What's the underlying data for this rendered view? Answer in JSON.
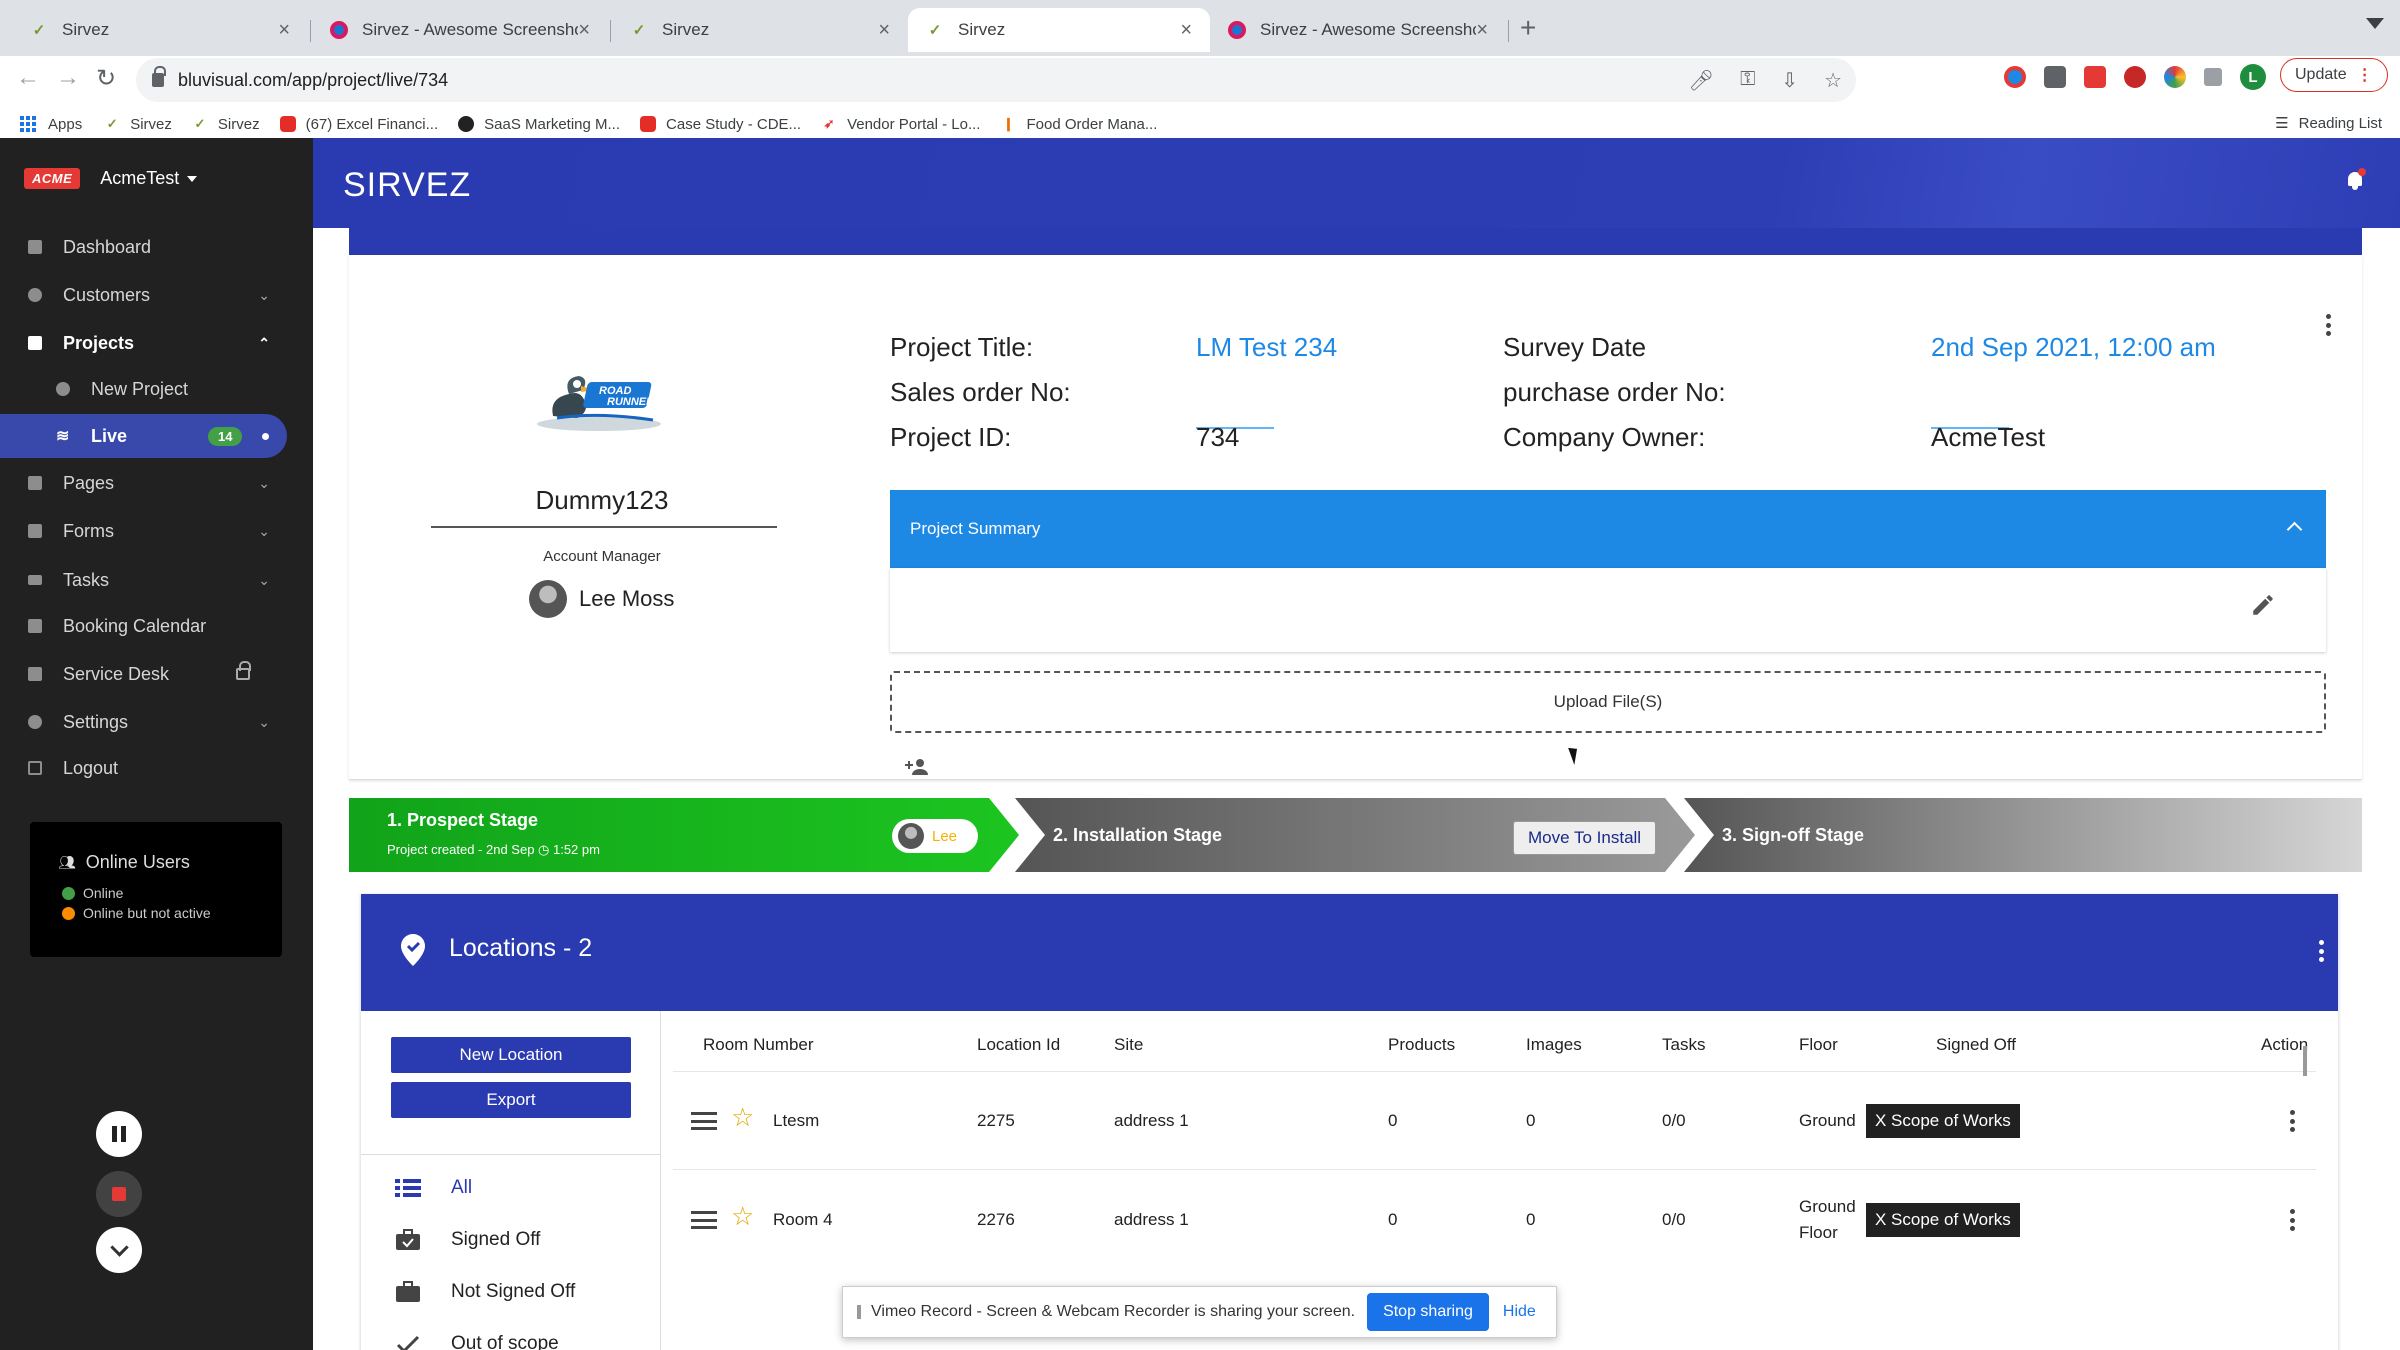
{
  "browser": {
    "tabs": [
      {
        "title": "Sirvez",
        "icon": "sirvez-check-icon"
      },
      {
        "title": "Sirvez - Awesome Screenshot",
        "icon": "awesome-screenshot-icon"
      },
      {
        "title": "Sirvez",
        "icon": "sirvez-check-icon"
      },
      {
        "title": "Sirvez",
        "icon": "sirvez-check-icon",
        "active": true
      },
      {
        "title": "Sirvez - Awesome Screenshot",
        "icon": "awesome-screenshot-icon"
      }
    ],
    "url": "bluvisual.com/app/project/live/734",
    "profile_letter": "L",
    "update_label": "Update",
    "bookmarks": [
      {
        "label": "Apps"
      },
      {
        "label": "Sirvez"
      },
      {
        "label": "Sirvez"
      },
      {
        "label": "(67) Excel Financi..."
      },
      {
        "label": "SaaS Marketing M..."
      },
      {
        "label": "Case Study - CDE..."
      },
      {
        "label": "Vendor Portal - Lo..."
      },
      {
        "label": "Food Order Mana..."
      }
    ],
    "reading_list": "Reading List"
  },
  "sidebar": {
    "brand_logo": "ACME",
    "company": "AcmeTest",
    "items": [
      {
        "label": "Dashboard"
      },
      {
        "label": "Customers"
      },
      {
        "label": "Projects"
      },
      {
        "label": "New Project"
      },
      {
        "label": "Live",
        "count": "14"
      },
      {
        "label": "Pages"
      },
      {
        "label": "Forms"
      },
      {
        "label": "Tasks"
      },
      {
        "label": "Booking Calendar"
      },
      {
        "label": "Service Desk"
      },
      {
        "label": "Settings"
      },
      {
        "label": "Logout"
      }
    ],
    "online": {
      "title": "Online Users",
      "online_label": "Online",
      "inactive_label": "Online but not active",
      "online_color": "#43a047",
      "inactive_color": "#fb8c00"
    }
  },
  "header": {
    "logo": "SIRVEZ"
  },
  "project": {
    "client_name": "Dummy123",
    "account_manager_label": "Account Manager",
    "account_manager": "Lee Moss",
    "logo_text": "ROAD RUNNER",
    "fields": {
      "title_label": "Project Title:",
      "title_value": "LM Test 234",
      "sales_label": "Sales order No:",
      "sales_value": "",
      "id_label": "Project ID:",
      "id_value": "734",
      "survey_label": "Survey Date",
      "survey_value": "2nd Sep 2021, 12:00 am",
      "po_label": "purchase order No:",
      "po_value": "",
      "owner_label": "Company Owner:",
      "owner_value": "AcmeTest"
    },
    "summary_label": "Project Summary",
    "upload_label": "Upload File(S)"
  },
  "stages": {
    "stage1_title": "1. Prospect Stage",
    "stage1_sub": "Project created - 2nd Sep ◷ 1:52 pm",
    "stage1_user": "Lee",
    "stage2_title": "2. Installation Stage",
    "move_label": "Move To Install",
    "stage3_title": "3. Sign-off Stage"
  },
  "locations": {
    "title": "Locations - 2",
    "new_label": "New Location",
    "export_label": "Export",
    "filters": [
      {
        "label": "All"
      },
      {
        "label": "Signed Off"
      },
      {
        "label": "Not Signed Off"
      },
      {
        "label": "Out of scope"
      }
    ],
    "columns": [
      "Room Number",
      "Location Id",
      "Site",
      "Products",
      "Images",
      "Tasks",
      "Floor",
      "Signed Off",
      "Action"
    ],
    "rows": [
      {
        "room": "Ltesm",
        "id": "2275",
        "site": "address 1",
        "products": "0",
        "images": "0",
        "tasks": "0/0",
        "floor": "Ground",
        "floor2": "",
        "signed": "X Scope of Works"
      },
      {
        "room": "Room 4",
        "id": "2276",
        "site": "address 1",
        "products": "0",
        "images": "0",
        "tasks": "0/0",
        "floor": "Ground",
        "floor2": "Floor",
        "signed": "X Scope of Works"
      }
    ]
  },
  "share_banner": {
    "text": "Vimeo Record - Screen & Webcam Recorder is sharing your screen.",
    "stop_label": "Stop sharing",
    "hide_label": "Hide"
  }
}
